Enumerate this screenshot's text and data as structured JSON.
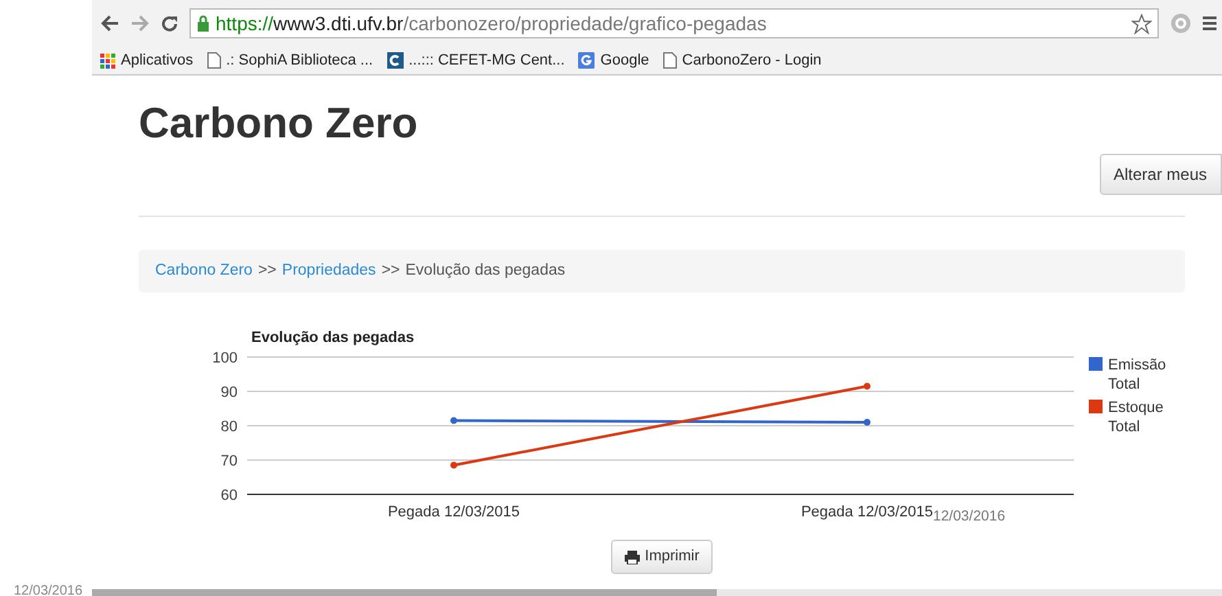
{
  "browser": {
    "url": {
      "scheme": "https://",
      "host": "www3.dti.ufv.br",
      "path": "/carbonozero/propriedade/grafico-pegadas"
    },
    "bookmarks": [
      {
        "label": "Aplicativos",
        "kind": "apps"
      },
      {
        "label": ".: SophiA Biblioteca ...",
        "kind": "page"
      },
      {
        "label": "...::: CEFET-MG Cent...",
        "kind": "site"
      },
      {
        "label": "Google",
        "kind": "google"
      },
      {
        "label": "CarbonoZero - Login",
        "kind": "page"
      }
    ]
  },
  "page": {
    "title": "Carbono Zero",
    "account_button": "Alterar meus",
    "breadcrumb": [
      {
        "label": "Carbono Zero",
        "link": true
      },
      {
        "label": ">>",
        "link": false
      },
      {
        "label": "Propriedades",
        "link": true
      },
      {
        "label": ">>",
        "link": false
      },
      {
        "label": "Evolução das pegadas",
        "link": false
      }
    ],
    "chart_data": {
      "type": "line",
      "title": "Evolução das pegadas",
      "grid": true,
      "legend": "right",
      "categories": [
        "Pegada 12/03/2015",
        "Pegada 12/03/2015"
      ],
      "ylim": [
        60,
        100
      ],
      "yticks": [
        60,
        70,
        80,
        90,
        100
      ],
      "series": [
        {
          "name": "Emissão Total",
          "color": "#3366cc",
          "marker": "circle",
          "values": [
            81.5,
            81
          ]
        },
        {
          "name": "Estoque Total",
          "color": "#dc3912",
          "marker": "circle",
          "values": [
            68.5,
            91.5
          ]
        }
      ]
    },
    "stray_date": "12/03/2016",
    "print_button": "Imprimir"
  },
  "footer_date": "12/03/2016"
}
